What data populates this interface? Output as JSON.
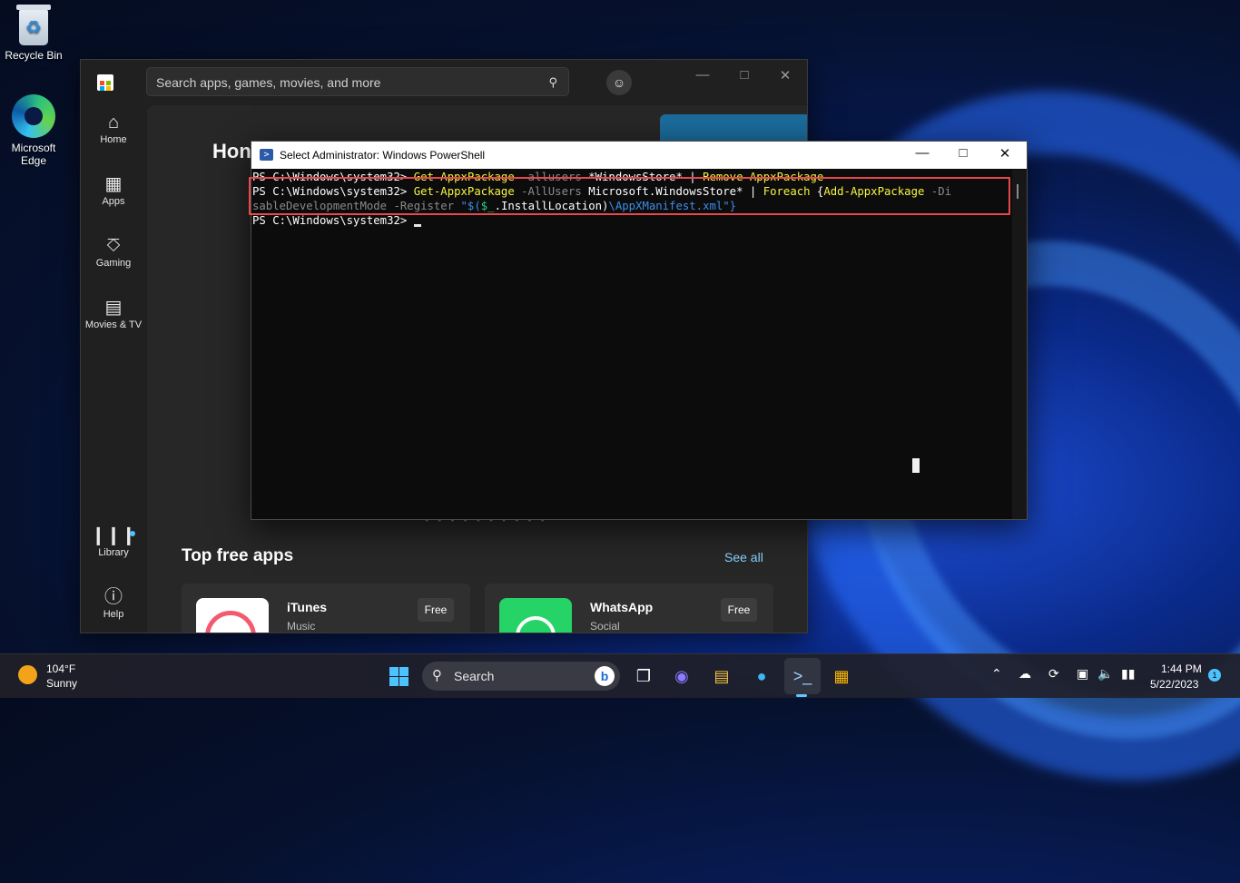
{
  "desktop": {
    "recycle_bin_label": "Recycle Bin",
    "edge_label": "Microsoft Edge"
  },
  "store": {
    "search_placeholder": "Search apps, games, movies, and more",
    "nav": [
      {
        "label": "Home",
        "icon": "home-icon"
      },
      {
        "label": "Apps",
        "icon": "apps-icon"
      },
      {
        "label": "Gaming",
        "icon": "gaming-icon"
      },
      {
        "label": "Movies & TV",
        "icon": "movies-icon"
      }
    ],
    "nav_bottom": [
      {
        "label": "Library",
        "icon": "library-icon"
      },
      {
        "label": "Help",
        "icon": "help-icon"
      }
    ],
    "hero_title": "Hon",
    "section_title": "Top free apps",
    "see_all": "See all",
    "apps": [
      {
        "name": "iTunes",
        "category": "Music",
        "price": "Free"
      },
      {
        "name": "WhatsApp",
        "category": "Social",
        "price": "Free"
      }
    ]
  },
  "powershell": {
    "title": "Select Administrator: Windows PowerShell",
    "lines": {
      "l1_prompt": "PS C:\\Windows\\system32> ",
      "l1_cmd": "Get-AppxPackage",
      "l1_param": " -allusers",
      "l1_rest": " *WindowsStore* | ",
      "l1_cmd2": "Remove-AppxPackage",
      "l2_prompt": "PS C:\\Windows\\system32> ",
      "l2_cmd": "Get-AppxPackage",
      "l2_param": " -AllUsers",
      "l2_arg": " Microsoft.WindowsStore*",
      "l2_pipe": " | ",
      "l2_cmd2": "Foreach",
      "l2_brace": " {",
      "l2_cmd3": "Add-AppxPackage",
      "l2_param2": " -Di",
      "l3_param": "sableDevelopmentMode",
      "l3_param2": " -Register",
      "l3_str1": " \"$(",
      "l3_var": "$_",
      "l3_str2": ".InstallLocation)",
      "l3_path": "\\AppXManifest.xml",
      "l3_end": "\"}",
      "l4_prompt": "PS C:\\Windows\\system32> "
    }
  },
  "taskbar": {
    "weather_temp": "104°F",
    "weather_condition": "Sunny",
    "search_label": "Search",
    "time": "1:44 PM",
    "date": "5/22/2023",
    "notification_count": "1"
  }
}
